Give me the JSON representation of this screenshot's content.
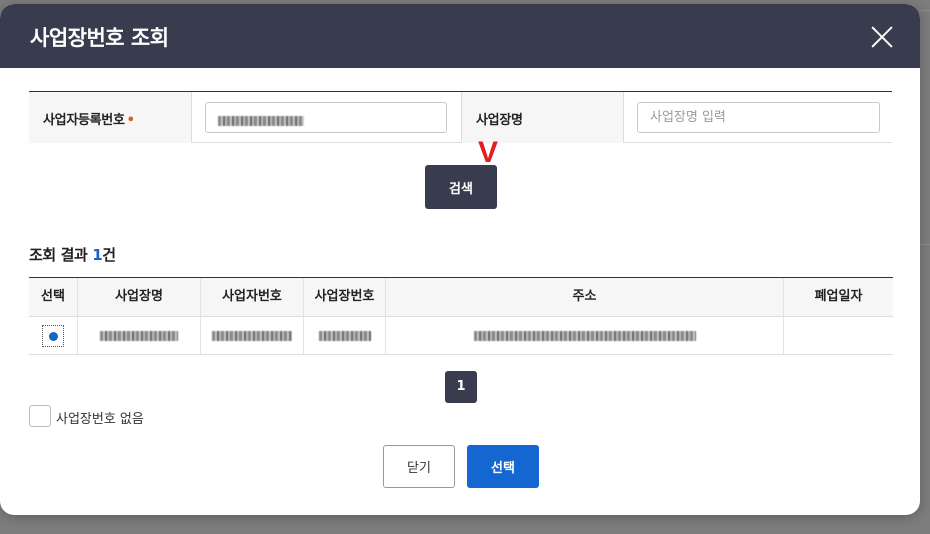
{
  "modal": {
    "title": "사업장번호 조회",
    "close_icon": "close-icon"
  },
  "search_form": {
    "biz_reg_label": "사업자등록번호",
    "required_mark": "•",
    "biz_reg_value": "",
    "biz_name_label": "사업장명",
    "biz_name_placeholder": "사업장명 입력",
    "search_button": "검색"
  },
  "annotation": {
    "mark": "V",
    "color": "#e02020"
  },
  "results": {
    "count_prefix": "조회 결과 ",
    "count": "1",
    "count_suffix": "건",
    "columns": [
      "선택",
      "사업장명",
      "사업자번호",
      "사업장번호",
      "주소",
      "폐업일자"
    ],
    "rows": [
      {
        "selected": true,
        "name": "",
        "biz_no": "",
        "site_no": "",
        "address": "",
        "closed_date": ""
      }
    ]
  },
  "pagination": {
    "current": "1"
  },
  "no_site_checkbox": {
    "label": "사업장번호 없음",
    "checked": false
  },
  "footer": {
    "close_button": "닫기",
    "select_button": "선택"
  },
  "colors": {
    "header_bg": "#393c4e",
    "primary_blue": "#1467d0",
    "required_orange": "#e35a1e"
  }
}
